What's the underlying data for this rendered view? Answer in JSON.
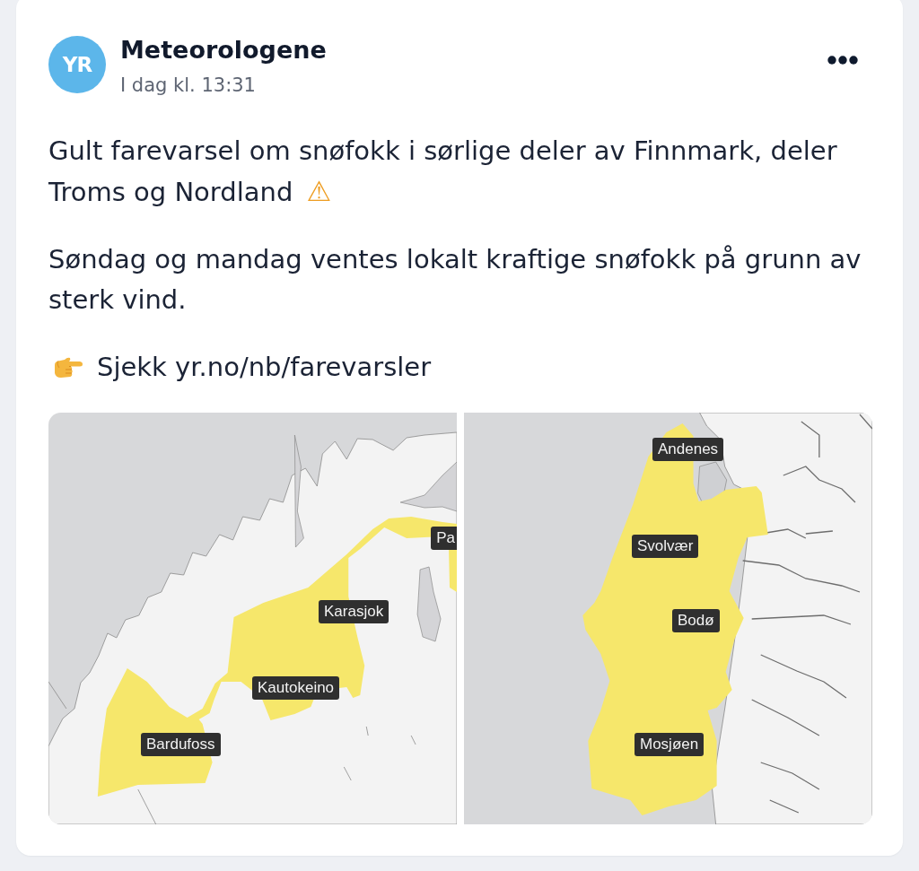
{
  "author": {
    "logo": "YR",
    "name": "Meteorologene",
    "timestamp": "I dag kl. 13:31"
  },
  "paragraphs": [
    {
      "kind": "warning",
      "text": "Gult farevarsel om snøfokk i sørlige deler av Finnmark, deler Troms og Nordland",
      "symbol": "⚠"
    },
    {
      "kind": "plain",
      "text": "Søndag og mandag ventes lokalt kraftige snøfokk på grunn av sterk vind."
    },
    {
      "kind": "pointer",
      "text": "Sjekk yr.no/nb/farevarsler"
    }
  ],
  "maps": [
    {
      "labels": [
        "Karasjok",
        "Kautokeino",
        "Bardufoss",
        "Pa"
      ]
    },
    {
      "labels": [
        "Andenes",
        "Svolvær",
        "Bodø",
        "Mosjøen"
      ]
    }
  ]
}
